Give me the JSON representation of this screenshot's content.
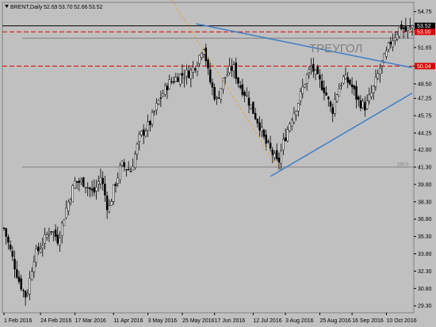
{
  "chart_data": {
    "type": "candlestick",
    "symbol_line": {
      "symbol": "BRENT,Daily",
      "open": "52.69",
      "high": "53.70",
      "low": "52.66",
      "close": "53.52"
    },
    "x_ticks": [
      "1 Feb 2016",
      "24 Feb 2016",
      "17 Mar 2016",
      "11 Apr 2016",
      "3 May 2016",
      "25 May 2016",
      "17 Jun 2016",
      "12 Jul 2016",
      "3 Aug 2016",
      "25 Aug 2016",
      "16 Sep 2016",
      "10 Oct 2016"
    ],
    "y_ticks": [
      "54.75",
      "53.20",
      "51.65",
      "50.05",
      "48.50",
      "47.25",
      "45.75",
      "44.25",
      "42.80",
      "41.30",
      "39.80",
      "38.30",
      "36.80",
      "35.30",
      "33.80",
      "32.30",
      "30.80",
      "29.30"
    ],
    "ylim": [
      28.7,
      55.55
    ],
    "bar_count": 191,
    "closes_anchors": [
      [
        0,
        36.0
      ],
      [
        8,
        31.5
      ],
      [
        12,
        30.0
      ],
      [
        16,
        33.5
      ],
      [
        20,
        34.5
      ],
      [
        25,
        36.0
      ],
      [
        29,
        35.0
      ],
      [
        33,
        37.5
      ],
      [
        38,
        40.0
      ],
      [
        43,
        40.0
      ],
      [
        48,
        39.0
      ],
      [
        52,
        40.5
      ],
      [
        56,
        37.5
      ],
      [
        59,
        39.5
      ],
      [
        63,
        41.5
      ],
      [
        68,
        41.0
      ],
      [
        73,
        44.0
      ],
      [
        78,
        45.0
      ],
      [
        83,
        47.0
      ],
      [
        88,
        48.5
      ],
      [
        94,
        49.2
      ],
      [
        100,
        49.5
      ],
      [
        104,
        50.5
      ],
      [
        107,
        52.0
      ],
      [
        110,
        49.0
      ],
      [
        114,
        47.0
      ],
      [
        118,
        49.0
      ],
      [
        123,
        50.0
      ],
      [
        126,
        48.5
      ],
      [
        130,
        47.5
      ],
      [
        134,
        46.0
      ],
      [
        137,
        45.0
      ],
      [
        140,
        43.5
      ],
      [
        144,
        42.5
      ],
      [
        147,
        41.5
      ],
      [
        150,
        43.5
      ],
      [
        154,
        45.5
      ],
      [
        158,
        47.0
      ],
      [
        162,
        49.0
      ],
      [
        165,
        50.0
      ],
      [
        168,
        49.0
      ],
      [
        172,
        48.0
      ],
      [
        176,
        46.0
      ],
      [
        178,
        47.5
      ],
      [
        182,
        49.0
      ],
      [
        186,
        48.5
      ],
      [
        190,
        47.0
      ],
      [
        194,
        46.5
      ],
      [
        198,
        48.0
      ],
      [
        202,
        50.0
      ],
      [
        205,
        51.0
      ],
      [
        207,
        52.0
      ],
      [
        210,
        52.8
      ],
      [
        213,
        53.5
      ],
      [
        216,
        53.0
      ],
      [
        219,
        53.52
      ]
    ],
    "label_positions": [
      [
        0,
        0
      ],
      [
        17,
        1
      ],
      [
        33,
        2
      ],
      [
        51,
        3
      ],
      [
        67,
        4
      ],
      [
        83,
        5
      ],
      [
        98,
        6
      ],
      [
        116,
        7
      ],
      [
        131,
        8
      ],
      [
        147,
        9
      ],
      [
        162,
        10
      ],
      [
        178,
        11
      ]
    ],
    "horizontal_lines": [
      {
        "price": 53.52,
        "style": "solid",
        "color": "#000000",
        "label": "53.52",
        "label_style": "black"
      },
      {
        "price": 53.0,
        "style": "dashed",
        "color": "#e00000",
        "label": "53.00",
        "label_style": "red"
      },
      {
        "price": 52.45,
        "style": "solid",
        "color": "#7f7f7f",
        "text": "61.8"
      },
      {
        "price": 50.04,
        "style": "dashed",
        "color": "#e00000",
        "label": "50.04",
        "label_style": "red"
      },
      {
        "price": 41.3,
        "style": "solid",
        "color": "#7f7f7f",
        "text": "100.0"
      }
    ],
    "trendlines": [
      {
        "name": "upper",
        "from": [
          103,
          53.7
        ],
        "to": [
          219,
          49.9
        ]
      },
      {
        "name": "lower",
        "from": [
          143,
          40.5
        ],
        "to": [
          219,
          47.7
        ]
      },
      {
        "name": "fibo-diagonal",
        "from": [
          87,
          56.5
        ],
        "to": [
          147,
          41.3
        ]
      }
    ],
    "annotation": "ТРЕУГОЛ"
  }
}
